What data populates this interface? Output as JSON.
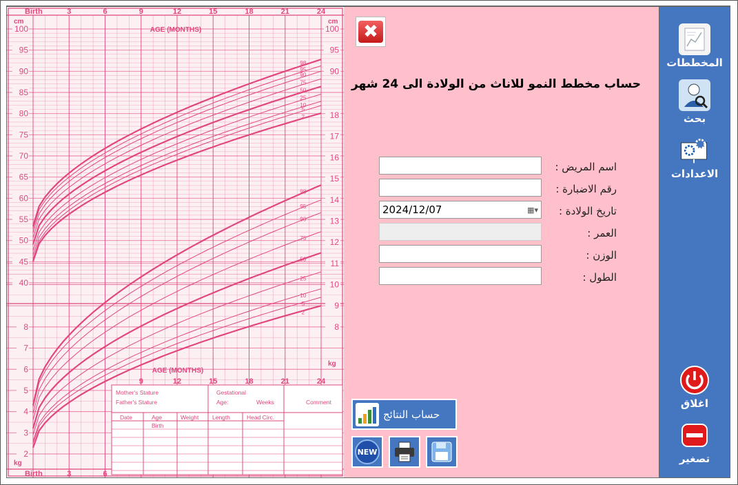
{
  "header": {
    "title": "حساب مخطط النمو للاناث من الولادة الى 24 شهر"
  },
  "form": {
    "patient_name_label": "اسم المريض :",
    "file_number_label": "رقم الاضبارة :",
    "birth_date_label": "تاريخ الولادة :",
    "birth_date_value": "2024/12/07",
    "age_label": "العمر :",
    "weight_label": "الوزن :",
    "height_label": "الطول :"
  },
  "buttons": {
    "close_label": "✖",
    "calc_label": "حساب النتائج",
    "new_label": "NEW"
  },
  "sidebar": {
    "charts_label": "المخططات",
    "search_label": "بحث",
    "settings_label": "الاعدادات",
    "exit_label": "اغلاق",
    "minimize_label": "تصغير"
  },
  "chart": {
    "birth_label": "Birth",
    "age_months_label": "AGE (MONTHS)",
    "cm_unit": "cm",
    "kg_unit": "kg",
    "months_ticks": [
      "3",
      "6",
      "9",
      "12",
      "15",
      "18",
      "21",
      "24"
    ],
    "cm_ticks_left": [
      "100",
      "95",
      "90",
      "85",
      "80",
      "75",
      "70",
      "65",
      "60",
      "55",
      "50",
      "45",
      "40"
    ],
    "cm_ticks_right": [
      "100",
      "95",
      "90"
    ],
    "kg_ticks_right": [
      "18",
      "17",
      "16",
      "15",
      "14",
      "13",
      "12",
      "11",
      "10",
      "9",
      "8"
    ],
    "kg_ticks_left": [
      "8",
      "7",
      "6",
      "5",
      "4",
      "3",
      "2"
    ],
    "percentiles_length": [
      "98",
      "95",
      "90",
      "75",
      "50",
      "25",
      "10",
      "5",
      "2"
    ],
    "percentiles_weight": [
      "98",
      "95",
      "90",
      "75",
      "50",
      "25",
      "10",
      "5",
      "2"
    ],
    "table": {
      "mothers_stature": "Mother's Stature",
      "fathers_stature": "Father's Stature",
      "gestational": "Gestational",
      "age_weeks": "Age:",
      "weeks": "Weeks",
      "comment": "Comment",
      "headers": [
        "Date",
        "Age",
        "Weight",
        "Length",
        "Head Circ."
      ],
      "birth_row": "Birth"
    }
  },
  "colors": {
    "pink_panel": "#ffc0cb",
    "sidebar_blue": "#4577c0",
    "chart_line": "#e0477f"
  }
}
